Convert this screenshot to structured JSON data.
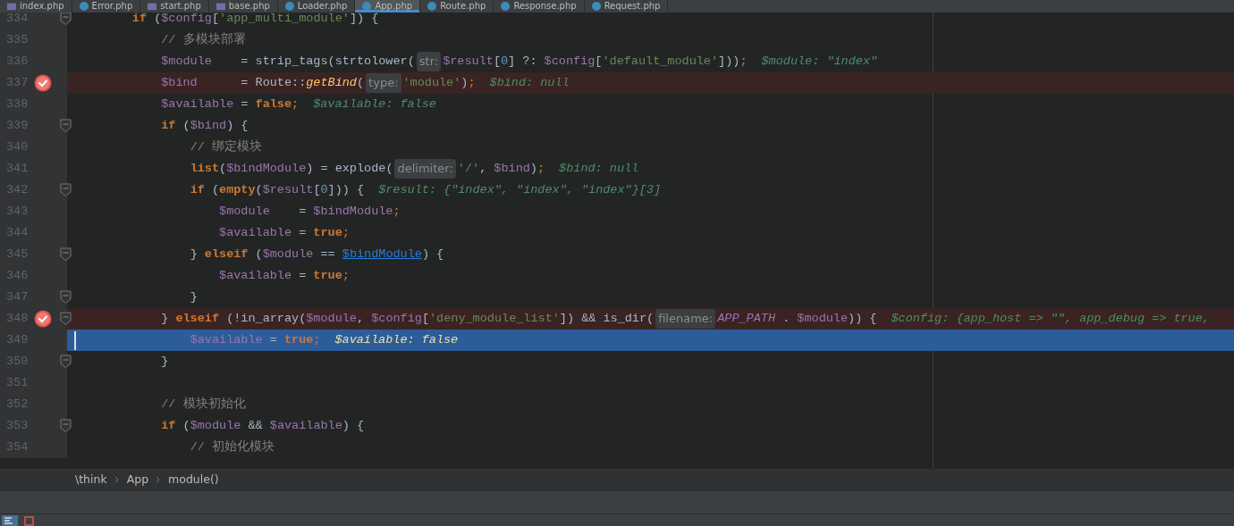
{
  "tabs": [
    {
      "label": "index.php",
      "kind": "php",
      "selected": false
    },
    {
      "label": "Error.php",
      "kind": "class",
      "selected": false
    },
    {
      "label": "start.php",
      "kind": "php",
      "selected": false
    },
    {
      "label": "base.php",
      "kind": "php",
      "selected": false
    },
    {
      "label": "Loader.php",
      "kind": "class",
      "selected": false
    },
    {
      "label": "App.php",
      "kind": "class",
      "selected": true
    },
    {
      "label": "Route.php",
      "kind": "class",
      "selected": false
    },
    {
      "label": "Response.php",
      "kind": "class",
      "selected": false
    },
    {
      "label": "Request.php",
      "kind": "class",
      "selected": false
    }
  ],
  "lines": [
    {
      "number": "334",
      "breakpoint": false,
      "fold": true,
      "current": false,
      "tokens": [
        {
          "kind": "k",
          "text": "        if"
        },
        {
          "kind": "p",
          "text": " ("
        },
        {
          "kind": "v",
          "text": "$config"
        },
        {
          "kind": "p",
          "text": "["
        },
        {
          "kind": "s",
          "text": "'app_multi_module'"
        },
        {
          "kind": "p",
          "text": "]) {"
        }
      ]
    },
    {
      "number": "335",
      "breakpoint": false,
      "fold": false,
      "current": false,
      "tokens": [
        {
          "kind": "c",
          "text": "            // 多模块部署"
        }
      ]
    },
    {
      "number": "336",
      "breakpoint": false,
      "fold": false,
      "current": false,
      "tokens": [
        {
          "kind": "v",
          "text": "            $module"
        },
        {
          "kind": "p",
          "text": "    = strip_tags(strtolower("
        },
        {
          "kind": "h",
          "text": "str:"
        },
        {
          "kind": "v",
          "text": "$result"
        },
        {
          "kind": "p",
          "text": "["
        },
        {
          "kind": "n",
          "text": "0"
        },
        {
          "kind": "p",
          "text": "] ?: "
        },
        {
          "kind": "v",
          "text": "$config"
        },
        {
          "kind": "p",
          "text": "["
        },
        {
          "kind": "s",
          "text": "'default_module'"
        },
        {
          "kind": "p",
          "text": "]))"
        },
        {
          "kind": "o",
          "text": ";"
        },
        {
          "kind": "d",
          "text": "$module: \"index\""
        }
      ]
    },
    {
      "number": "337",
      "breakpoint": true,
      "fold": false,
      "current": false,
      "tokens": [
        {
          "kind": "v",
          "text": "            $bind"
        },
        {
          "kind": "p",
          "text": "      = Route::"
        },
        {
          "kind": "f",
          "text": "getBind"
        },
        {
          "kind": "p",
          "text": "("
        },
        {
          "kind": "h",
          "text": "type:"
        },
        {
          "kind": "s",
          "text": "'module'"
        },
        {
          "kind": "p",
          "text": ")"
        },
        {
          "kind": "o",
          "text": ";"
        },
        {
          "kind": "d",
          "text": "$bind: null"
        }
      ]
    },
    {
      "number": "338",
      "breakpoint": false,
      "fold": false,
      "current": false,
      "tokens": [
        {
          "kind": "v",
          "text": "            $available"
        },
        {
          "kind": "p",
          "text": " = "
        },
        {
          "kind": "k",
          "text": "false"
        },
        {
          "kind": "o",
          "text": ";"
        },
        {
          "kind": "d",
          "text": "$available: false"
        }
      ]
    },
    {
      "number": "339",
      "breakpoint": false,
      "fold": true,
      "current": false,
      "tokens": [
        {
          "kind": "k",
          "text": "            if"
        },
        {
          "kind": "p",
          "text": " ("
        },
        {
          "kind": "v",
          "text": "$bind"
        },
        {
          "kind": "p",
          "text": ") {"
        }
      ]
    },
    {
      "number": "340",
      "breakpoint": false,
      "fold": false,
      "current": false,
      "tokens": [
        {
          "kind": "c",
          "text": "                // 绑定模块"
        }
      ]
    },
    {
      "number": "341",
      "breakpoint": false,
      "fold": false,
      "current": false,
      "tokens": [
        {
          "kind": "k",
          "text": "                list"
        },
        {
          "kind": "p",
          "text": "("
        },
        {
          "kind": "v",
          "text": "$bindModule"
        },
        {
          "kind": "p",
          "text": ") = explode("
        },
        {
          "kind": "h",
          "text": "delimiter:"
        },
        {
          "kind": "s",
          "text": "'/'"
        },
        {
          "kind": "p",
          "text": ", "
        },
        {
          "kind": "v",
          "text": "$bind"
        },
        {
          "kind": "p",
          "text": ")"
        },
        {
          "kind": "o",
          "text": ";"
        },
        {
          "kind": "d",
          "text": "$bind: null"
        }
      ]
    },
    {
      "number": "342",
      "breakpoint": false,
      "fold": true,
      "current": false,
      "tokens": [
        {
          "kind": "k",
          "text": "                if"
        },
        {
          "kind": "p",
          "text": " ("
        },
        {
          "kind": "k",
          "text": "empty"
        },
        {
          "kind": "p",
          "text": "("
        },
        {
          "kind": "v",
          "text": "$result"
        },
        {
          "kind": "p",
          "text": "["
        },
        {
          "kind": "n",
          "text": "0"
        },
        {
          "kind": "p",
          "text": "])) {"
        },
        {
          "kind": "d",
          "text": "$result: {\"index\", \"index\", \"index\"}[3]"
        }
      ]
    },
    {
      "number": "343",
      "breakpoint": false,
      "fold": false,
      "current": false,
      "tokens": [
        {
          "kind": "v",
          "text": "                    $module"
        },
        {
          "kind": "p",
          "text": "    = "
        },
        {
          "kind": "v",
          "text": "$bindModule"
        },
        {
          "kind": "o",
          "text": ";"
        }
      ]
    },
    {
      "number": "344",
      "breakpoint": false,
      "fold": false,
      "current": false,
      "tokens": [
        {
          "kind": "v",
          "text": "                    $available"
        },
        {
          "kind": "p",
          "text": " = "
        },
        {
          "kind": "k",
          "text": "true"
        },
        {
          "kind": "o",
          "text": ";"
        }
      ]
    },
    {
      "number": "345",
      "breakpoint": false,
      "fold": true,
      "current": false,
      "tokens": [
        {
          "kind": "p",
          "text": "                } "
        },
        {
          "kind": "k",
          "text": "elseif"
        },
        {
          "kind": "p",
          "text": " ("
        },
        {
          "kind": "v",
          "text": "$module"
        },
        {
          "kind": "p",
          "text": " == "
        },
        {
          "kind": "u",
          "text": "$bindModule"
        },
        {
          "kind": "p",
          "text": ") {"
        }
      ]
    },
    {
      "number": "346",
      "breakpoint": false,
      "fold": false,
      "current": false,
      "tokens": [
        {
          "kind": "v",
          "text": "                    $available"
        },
        {
          "kind": "p",
          "text": " = "
        },
        {
          "kind": "k",
          "text": "true"
        },
        {
          "kind": "o",
          "text": ";"
        }
      ]
    },
    {
      "number": "347",
      "breakpoint": false,
      "fold": true,
      "current": false,
      "tokens": [
        {
          "kind": "p",
          "text": "                }"
        }
      ]
    },
    {
      "number": "348",
      "breakpoint": true,
      "fold": true,
      "current": false,
      "tokens": [
        {
          "kind": "p",
          "text": "            } "
        },
        {
          "kind": "k",
          "text": "elseif"
        },
        {
          "kind": "p",
          "text": " (!in_array("
        },
        {
          "kind": "v",
          "text": "$module"
        },
        {
          "kind": "p",
          "text": ", "
        },
        {
          "kind": "v",
          "text": "$config"
        },
        {
          "kind": "p",
          "text": "["
        },
        {
          "kind": "s",
          "text": "'deny_module_list'"
        },
        {
          "kind": "p",
          "text": "]) && is_dir("
        },
        {
          "kind": "h",
          "text": "filename:"
        },
        {
          "kind": "i",
          "text": "APP_PATH"
        },
        {
          "kind": "p",
          "text": " . "
        },
        {
          "kind": "v",
          "text": "$module"
        },
        {
          "kind": "p",
          "text": ")) {"
        },
        {
          "kind": "d",
          "text": "$config: {app_host => \"\", app_debug => true,"
        }
      ]
    },
    {
      "number": "349",
      "breakpoint": false,
      "fold": false,
      "current": true,
      "tokens": [
        {
          "kind": "v",
          "text": "                $available"
        },
        {
          "kind": "p",
          "text": " = "
        },
        {
          "kind": "k",
          "text": "true"
        },
        {
          "kind": "o",
          "text": ";"
        },
        {
          "kind": "d",
          "text": "$available: false"
        }
      ]
    },
    {
      "number": "350",
      "breakpoint": false,
      "fold": true,
      "current": false,
      "tokens": [
        {
          "kind": "p",
          "text": "            }"
        }
      ]
    },
    {
      "number": "351",
      "breakpoint": false,
      "fold": false,
      "current": false
    },
    {
      "number": "352",
      "breakpoint": false,
      "fold": false,
      "current": false,
      "tokens": [
        {
          "kind": "c",
          "text": "            // 模块初始化"
        }
      ]
    },
    {
      "number": "353",
      "breakpoint": false,
      "fold": true,
      "current": false,
      "tokens": [
        {
          "kind": "k",
          "text": "            if"
        },
        {
          "kind": "p",
          "text": " ("
        },
        {
          "kind": "v",
          "text": "$module"
        },
        {
          "kind": "p",
          "text": " && "
        },
        {
          "kind": "v",
          "text": "$available"
        },
        {
          "kind": "p",
          "text": ") {"
        }
      ]
    },
    {
      "number": "354",
      "breakpoint": false,
      "fold": false,
      "current": false,
      "tokens": [
        {
          "kind": "c",
          "text": "                // 初始化模块"
        }
      ]
    }
  ],
  "breadcrumb": [
    "\\think",
    "App",
    "module()"
  ]
}
